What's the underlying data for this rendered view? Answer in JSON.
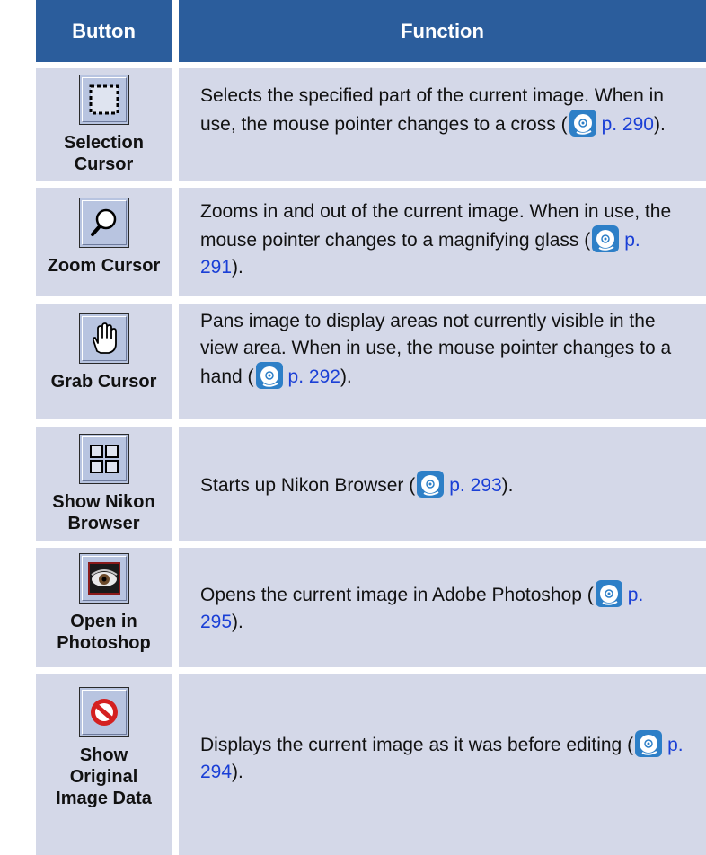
{
  "header": {
    "button": "Button",
    "function": "Function"
  },
  "rows": [
    {
      "name": "Selection\nCursor",
      "icon": "selection-marquee-icon",
      "pre": "Selects the specified part of the current image. When in use, the mouse pointer changes to a cross (",
      "page": "p. 290",
      "post": ")."
    },
    {
      "name": "Zoom Cursor",
      "icon": "magnifier-icon",
      "pre": "Zooms in and out of the current image. When in use, the mouse pointer changes to a magnifying glass (",
      "page": "p. 291",
      "post": ")."
    },
    {
      "name": "Grab Cursor",
      "icon": "hand-icon",
      "pre": "Pans image to display areas not currently visible in the view area. When in use, the mouse pointer changes to a hand (",
      "page": "p. 292",
      "post": ")."
    },
    {
      "name": "Show Nikon\nBrowser",
      "icon": "browser-grid-icon",
      "pre": "Starts up Nikon Browser (",
      "page": "p. 293",
      "post": ")."
    },
    {
      "name": "Open in\nPhotoshop",
      "icon": "photoshop-eye-icon",
      "pre": "Opens the current image in Adobe Photoshop (",
      "page": "p. 295",
      "post": ")."
    },
    {
      "name": "Show\nOriginal\nImage Data",
      "icon": "prohibited-icon",
      "pre": "Displays the current image as it was before editing (",
      "page": "p. 294",
      "post": ")."
    }
  ],
  "colors": {
    "header_bg": "#2b5d9c",
    "cell_bg": "#d4d8e8",
    "link": "#1a3fd6"
  }
}
